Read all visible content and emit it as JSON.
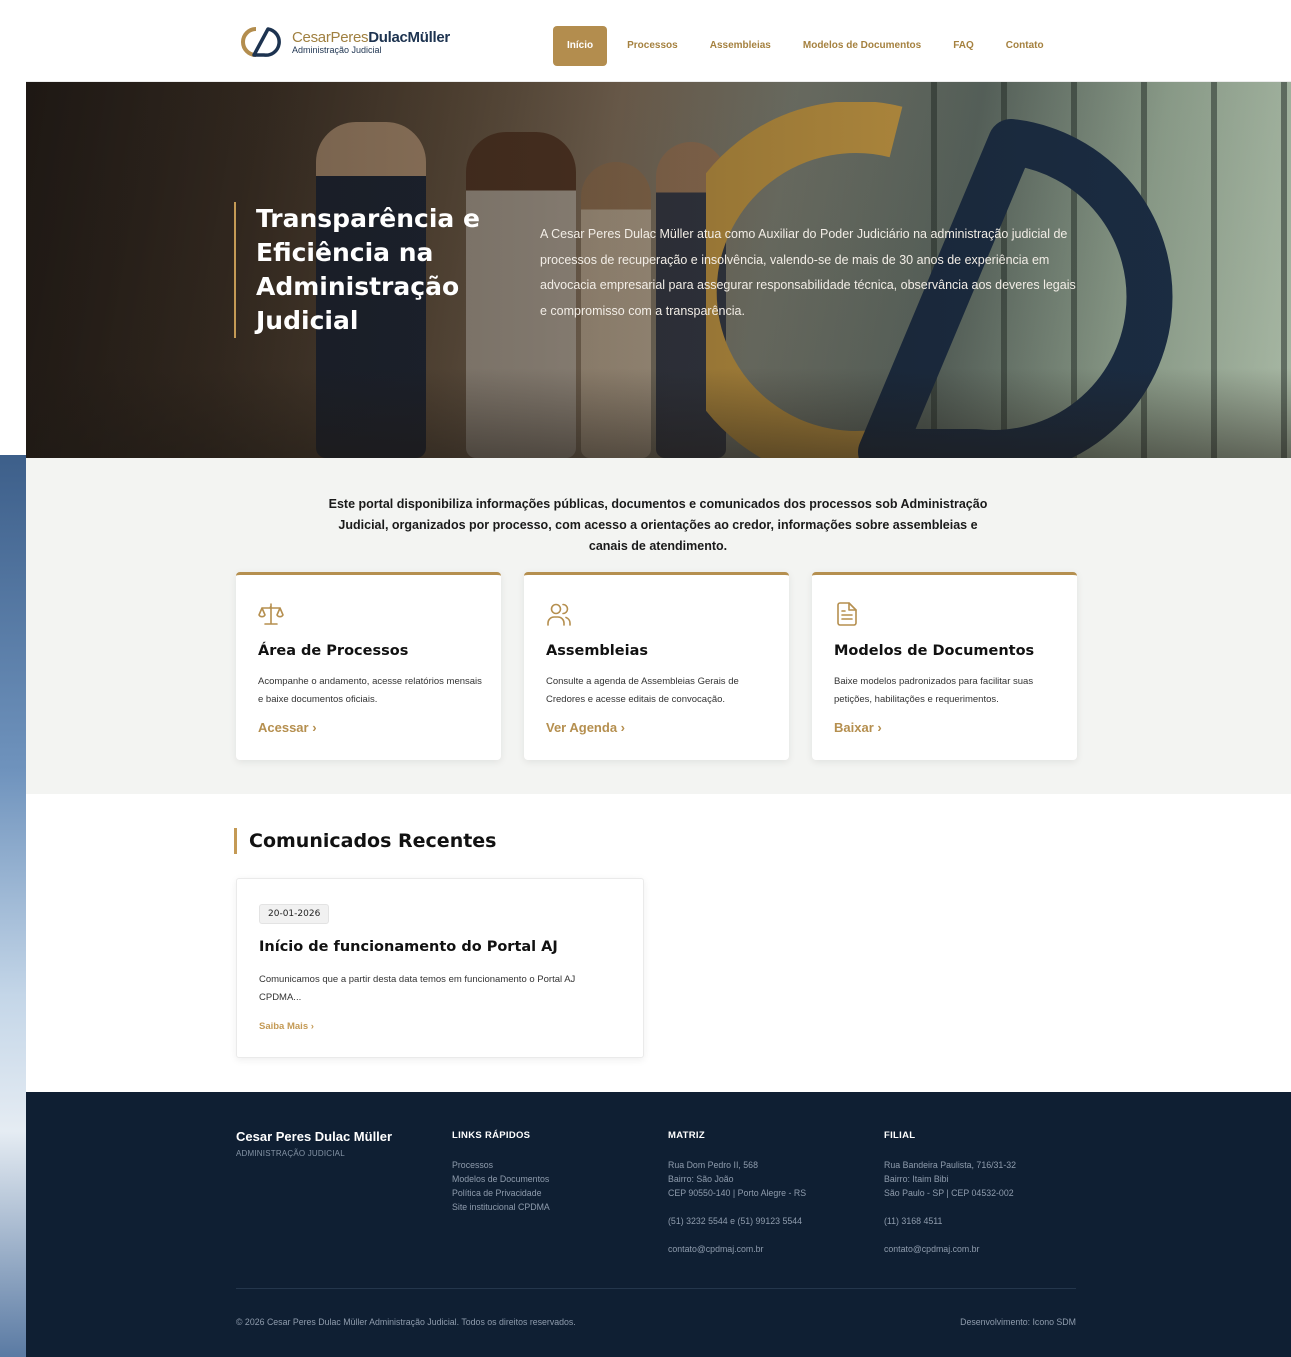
{
  "logo": {
    "name_a": "CesarPeres",
    "name_b": "DulacMüller",
    "subtitle": "Administração Judicial"
  },
  "nav": {
    "items": [
      {
        "label": "Início",
        "active": true
      },
      {
        "label": "Processos",
        "active": false
      },
      {
        "label": "Assembleias",
        "active": false
      },
      {
        "label": "Modelos de Documentos",
        "active": false
      },
      {
        "label": "FAQ",
        "active": false
      },
      {
        "label": "Contato",
        "active": false
      }
    ]
  },
  "hero": {
    "title": "Transparência e Eficiência na Administração Judicial",
    "text": "A Cesar Peres Dulac Müller atua como Auxiliar do Poder Judiciário na administração judicial de processos de recuperação e insolvência, valendo-se de mais de 30 anos de experiência em advocacia empresarial para assegurar responsabilidade técnica, observância aos deveres legais e compromisso com a transparência."
  },
  "intro": {
    "text": "Este portal disponibiliza informações públicas, documentos e comunicados dos processos sob Administração Judicial, organizados por processo, com acesso a orientações ao credor, informações sobre assembleias e canais de atendimento."
  },
  "cards": [
    {
      "icon": "scales-icon",
      "title": "Área de Processos",
      "desc": "Acompanhe o andamento, acesse relatórios mensais e baixe documentos oficiais.",
      "link": "Acessar ›"
    },
    {
      "icon": "users-icon",
      "title": "Assembleias",
      "desc": "Consulte a agenda de Assembleias Gerais de Credores e acesse editais de convocação.",
      "link": "Ver Agenda ›"
    },
    {
      "icon": "document-icon",
      "title": "Modelos de Documentos",
      "desc": "Baixe modelos padronizados para facilitar suas petições, habilitações e requerimentos.",
      "link": "Baixar ›"
    }
  ],
  "news": {
    "title": "Comunicados Recentes",
    "items": [
      {
        "date": "20-01-2026",
        "title": "Início de funcionamento do Portal AJ",
        "desc": "Comunicamos que a partir desta data temos em funcionamento o Portal AJ CPDMA...",
        "link": "Saiba Mais ›"
      }
    ]
  },
  "footer": {
    "brand": "Cesar Peres Dulac Müller",
    "brand_sub": "ADMINISTRAÇÃO JUDICIAL",
    "links_heading": "LINKS RÁPIDOS",
    "links": [
      "Processos",
      "Modelos de Documentos",
      "Política de Privacidade",
      "Site institucional CPDMA"
    ],
    "matriz": {
      "heading": "MATRIZ",
      "address": [
        "Rua Dom Pedro II, 568",
        "Bairro: São João",
        "CEP 90550-140 | Porto Alegre - RS"
      ],
      "phone": "(51) 3232 5544 e (51) 99123 5544",
      "email": "contato@cpdmaj.com.br"
    },
    "filial": {
      "heading": "FILIAL",
      "address": [
        "Rua Bandeira Paulista, 716/31-32",
        "Bairro: Itaim Bibi",
        "São Paulo - SP | CEP 04532-002"
      ],
      "phone": "(11) 3168 4511",
      "email": "contato@cpdmaj.com.br"
    },
    "copyright": "© 2026 Cesar Peres Dulac Müller Administração Judicial. Todos os direitos reservados.",
    "dev": "Desenvolvimento: Icono SDM"
  },
  "colors": {
    "gold": "#b38d4e",
    "navy": "#0f1f33",
    "light_bg": "#f3f4f2"
  }
}
